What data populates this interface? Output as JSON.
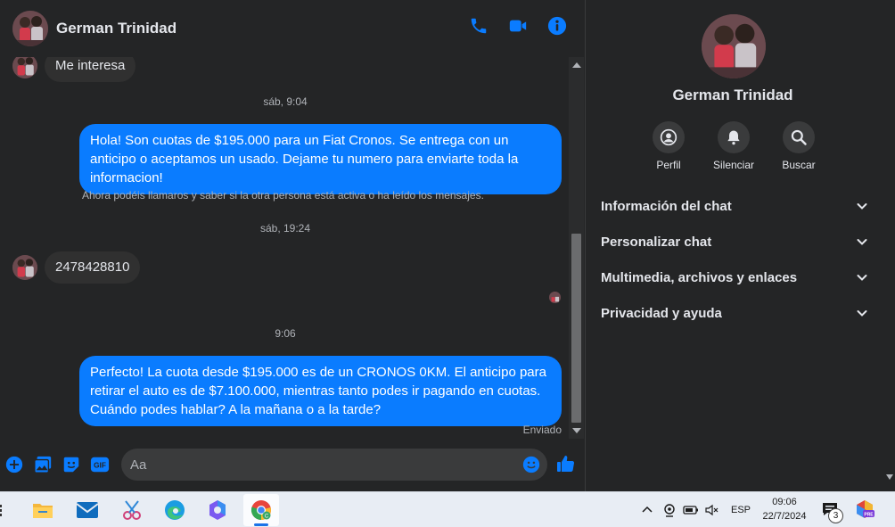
{
  "contact": {
    "name": "German Trinidad"
  },
  "messages": {
    "m1": "Me interesa",
    "t1": "sáb, 9:04",
    "m2": "Hola! Son cuotas de $195.000 para un Fiat Cronos. Se entrega con un anticipo o aceptamos un usado. Dejame tu numero para enviarte toda la informacion!",
    "sys": "Ahora podéis llamaros y saber si la otra persona está activa o ha leído los mensajes.",
    "t2": "sáb, 19:24",
    "m3": "2478428810",
    "t3": "9:06",
    "m4": "Perfecto! La cuota desde $195.000 es de un CRONOS 0KM. El anticipo para retirar el auto es de $7.100.000, mientras tanto podes ir pagando en cuotas. Cuándo podes hablar? A la mañana o a la tarde?",
    "status": "Enviado"
  },
  "composer": {
    "placeholder": "Aa"
  },
  "panel": {
    "actions": {
      "profile": "Perfil",
      "mute": "Silenciar",
      "search": "Buscar"
    },
    "sections": {
      "chat_info": "Información del chat",
      "customize": "Personalizar chat",
      "media": "Multimedia, archivos y enlaces",
      "privacy": "Privacidad y ayuda"
    }
  },
  "taskbar": {
    "language": "ESP",
    "time": "09:06",
    "date": "22/7/2024",
    "notifications": "3"
  },
  "colors": {
    "accent": "#0a7cff",
    "background": "#242526",
    "bubble_in": "#303030"
  },
  "icons": [
    "phone-icon",
    "video-icon",
    "info-icon",
    "plus-icon",
    "image-icon",
    "sticker-icon",
    "gif-icon",
    "emoji-icon",
    "like-icon",
    "profile-icon",
    "bell-icon",
    "search-icon",
    "chevron-down-icon"
  ]
}
